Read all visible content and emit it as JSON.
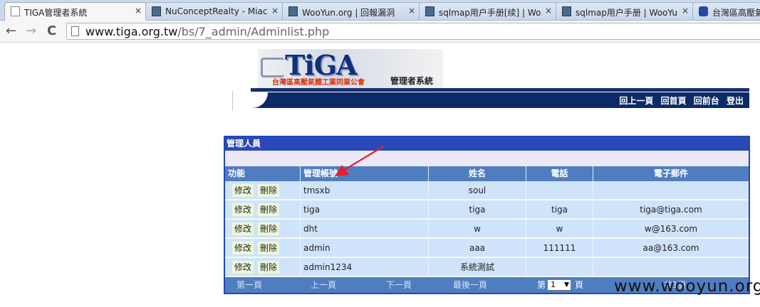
{
  "browser": {
    "tabs": [
      {
        "title": "TIGA管理者系統",
        "icon": "page-icon",
        "active": true
      },
      {
        "title": "NuConceptRealty - Miac",
        "icon": "image-icon",
        "active": false
      },
      {
        "title": "WooYun.org | 回報漏洞",
        "icon": "image-icon",
        "active": false
      },
      {
        "title": "sqlmap用户手册[续] | Wo",
        "icon": "image-icon",
        "active": false
      },
      {
        "title": "sqlmap用户手册 | WooYu",
        "icon": "image-icon",
        "active": false
      },
      {
        "title": "台灣區高壓氣",
        "icon": "paw-icon",
        "active": false
      }
    ],
    "close_glyph": "×",
    "back_glyph": "←",
    "forward_glyph": "→",
    "reload_glyph": "C",
    "url_domain": "www.tiga.org.tw",
    "url_path": "/bs/7_admin/Adminlist.php"
  },
  "header": {
    "logo_text": "TiGA",
    "logo_subtitle": "台灣區高壓氣體工業同業公會",
    "system_title": "管理者系統",
    "nav_links": [
      "回上一頁",
      "回首頁",
      "回前台",
      "登出"
    ]
  },
  "panel": {
    "title": "管理人員",
    "columns": [
      "功能",
      "管理帳號",
      "姓名",
      "電話",
      "電子郵件"
    ],
    "edit_label": "修改",
    "delete_label": "刪除",
    "rows": [
      {
        "account": "tmsxb",
        "name": "soul",
        "phone": "",
        "email": ""
      },
      {
        "account": "tiga",
        "name": "tiga",
        "phone": "tiga",
        "email": "tiga@tiga.com"
      },
      {
        "account": "dht",
        "name": "w",
        "phone": "w",
        "email": "w@163.com"
      },
      {
        "account": "admin",
        "name": "aaa",
        "phone": "111111",
        "email": "aa@163.com"
      },
      {
        "account": "admin1234",
        "name": "系統測試",
        "phone": "",
        "email": ""
      }
    ],
    "pager": {
      "first": "第一頁",
      "prev": "上一頁",
      "next": "下一頁",
      "last": "最後一頁",
      "page_prefix": "第",
      "page_value": "1",
      "page_suffix": "頁",
      "total": "共1頁"
    }
  },
  "watermark": "www.wooyun.org",
  "colors": {
    "panel_border": "#1f48b9",
    "header_row": "#4f7ec0",
    "cell_bg": "#cfe3fb",
    "annotation_arrow": "#e0202a"
  }
}
